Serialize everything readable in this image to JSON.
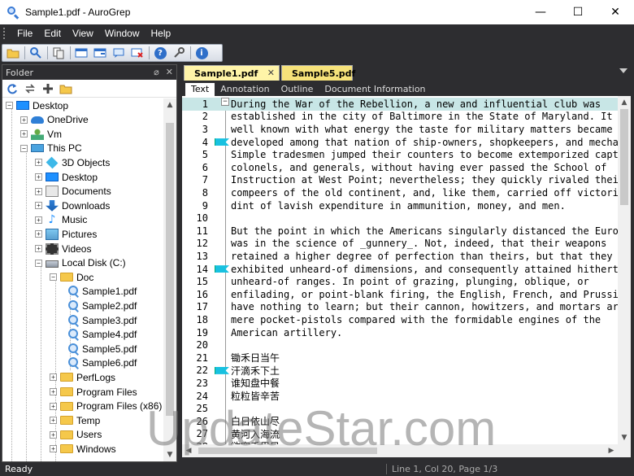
{
  "window": {
    "title": "Sample1.pdf - AuroGrep"
  },
  "window_controls": {
    "minimize": "—",
    "maximize": "☐",
    "close": "✕"
  },
  "menu": [
    {
      "label": "File"
    },
    {
      "label": "Edit"
    },
    {
      "label": "View"
    },
    {
      "label": "Window"
    },
    {
      "label": "Help"
    }
  ],
  "toolbar": {
    "icons": [
      "open-folder-icon",
      "search-icon",
      "copy-icon",
      "window-icon",
      "new-window-icon",
      "chat-icon",
      "search-stop-icon",
      "help-icon",
      "settings-icon",
      "info-icon"
    ]
  },
  "folder_panel": {
    "title": "Folder",
    "pin": "⌀",
    "close": "✕",
    "tree": [
      {
        "label": "Desktop",
        "icon": "desktop-icon",
        "expander": "−"
      },
      {
        "label": "OneDrive",
        "icon": "onedrive-icon",
        "expander": "+"
      },
      {
        "label": "Vm",
        "icon": "user-icon",
        "expander": "+"
      },
      {
        "label": "This PC",
        "icon": "pc-icon",
        "expander": "−"
      },
      {
        "label": "3D Objects",
        "icon": "3d-objects-icon",
        "expander": "+"
      },
      {
        "label": "Desktop",
        "icon": "desktop-icon",
        "expander": "+"
      },
      {
        "label": "Documents",
        "icon": "documents-icon",
        "expander": "+"
      },
      {
        "label": "Downloads",
        "icon": "downloads-icon",
        "expander": "+"
      },
      {
        "label": "Music",
        "icon": "music-icon",
        "expander": "+"
      },
      {
        "label": "Pictures",
        "icon": "pictures-icon",
        "expander": "+"
      },
      {
        "label": "Videos",
        "icon": "videos-icon",
        "expander": "+"
      },
      {
        "label": "Local Disk (C:)",
        "icon": "disk-icon",
        "expander": "−"
      },
      {
        "label": "Doc",
        "icon": "folder-icon",
        "expander": "−"
      },
      {
        "label": "Sample1.pdf",
        "icon": "pdf-file-icon",
        "expander": ""
      },
      {
        "label": "Sample2.pdf",
        "icon": "pdf-file-icon",
        "expander": ""
      },
      {
        "label": "Sample3.pdf",
        "icon": "pdf-file-icon",
        "expander": ""
      },
      {
        "label": "Sample4.pdf",
        "icon": "pdf-file-icon",
        "expander": ""
      },
      {
        "label": "Sample5.pdf",
        "icon": "pdf-file-icon",
        "expander": ""
      },
      {
        "label": "Sample6.pdf",
        "icon": "pdf-file-icon",
        "expander": ""
      },
      {
        "label": "PerfLogs",
        "icon": "folder-icon",
        "expander": "+"
      },
      {
        "label": "Program Files",
        "icon": "folder-icon",
        "expander": "+"
      },
      {
        "label": "Program Files (x86)",
        "icon": "folder-icon",
        "expander": "+"
      },
      {
        "label": "Temp",
        "icon": "folder-icon",
        "expander": "+"
      },
      {
        "label": "Users",
        "icon": "folder-icon",
        "expander": "+"
      },
      {
        "label": "Windows",
        "icon": "folder-icon",
        "expander": "+"
      }
    ]
  },
  "doc_tabs": [
    {
      "label": "Sample1.pdf",
      "active": true,
      "close": "✕"
    },
    {
      "label": "Sample5.pdf",
      "active": false
    }
  ],
  "sub_tabs": [
    {
      "label": "Text",
      "active": true
    },
    {
      "label": "Annotation"
    },
    {
      "label": "Outline"
    },
    {
      "label": "Document Information"
    }
  ],
  "document": {
    "fold_symbol": "−",
    "lines": [
      {
        "n": "1",
        "text": "During the War of the Rebellion, a new and influential club was",
        "highlight": true
      },
      {
        "n": "2",
        "text": "established in the city of Baltimore in the State of Maryland. It is"
      },
      {
        "n": "3",
        "text": "well known with what energy the taste for military matters became"
      },
      {
        "n": "4",
        "text": "developed among that nation of ship-owners, shopkeepers, and mechani",
        "bookmark": true
      },
      {
        "n": "5",
        "text": "Simple tradesmen jumped their counters to become extemporized captair"
      },
      {
        "n": "6",
        "text": "colonels, and generals, without having ever passed the School of"
      },
      {
        "n": "7",
        "text": "Instruction at West Point; nevertheless; they quickly rivaled their"
      },
      {
        "n": "8",
        "text": "compeers of the old continent, and, like them, carried off victories by"
      },
      {
        "n": "9",
        "text": "dint of lavish expenditure in ammunition, money, and men."
      },
      {
        "n": "10",
        "text": ""
      },
      {
        "n": "11",
        "text": "But the point in which the Americans singularly distanced the Europeans"
      },
      {
        "n": "12",
        "text": "was in the science of _gunnery_. Not, indeed, that their weapons"
      },
      {
        "n": "13",
        "text": "retained a higher degree of perfection than theirs, but that they"
      },
      {
        "n": "14",
        "text": "exhibited unheard-of dimensions, and consequently attained hitherto",
        "bookmark": true
      },
      {
        "n": "15",
        "text": "unheard-of ranges. In point of grazing, plunging, oblique, or"
      },
      {
        "n": "16",
        "text": "enfilading, or point-blank firing, the English, French, and Prussians"
      },
      {
        "n": "17",
        "text": "have nothing to learn; but their cannon, howitzers, and mortars are"
      },
      {
        "n": "18",
        "text": "mere pocket-pistols compared with the formidable engines of the"
      },
      {
        "n": "19",
        "text": "American artillery."
      },
      {
        "n": "20",
        "text": ""
      },
      {
        "n": "21",
        "text": "锄禾日当午"
      },
      {
        "n": "22",
        "text": "汗滴禾下土",
        "bookmark": true
      },
      {
        "n": "23",
        "text": "谁知盘中餐"
      },
      {
        "n": "24",
        "text": "粒粒皆辛苦"
      },
      {
        "n": "25",
        "text": ""
      },
      {
        "n": "26",
        "text": "白日依山尽"
      },
      {
        "n": "27",
        "text": "黄河入海流"
      },
      {
        "n": "28",
        "text": "欲穷千里目"
      }
    ]
  },
  "status": {
    "left": "Ready",
    "right": "Line 1, Col 20, Page 1/3"
  },
  "watermark": "UpdateStar.com",
  "colors": {
    "chrome": "#2d2d30",
    "highlight_line": "#c8e6e6",
    "bookmark": "#18c1e0",
    "active_tab": "#fff4a8"
  }
}
